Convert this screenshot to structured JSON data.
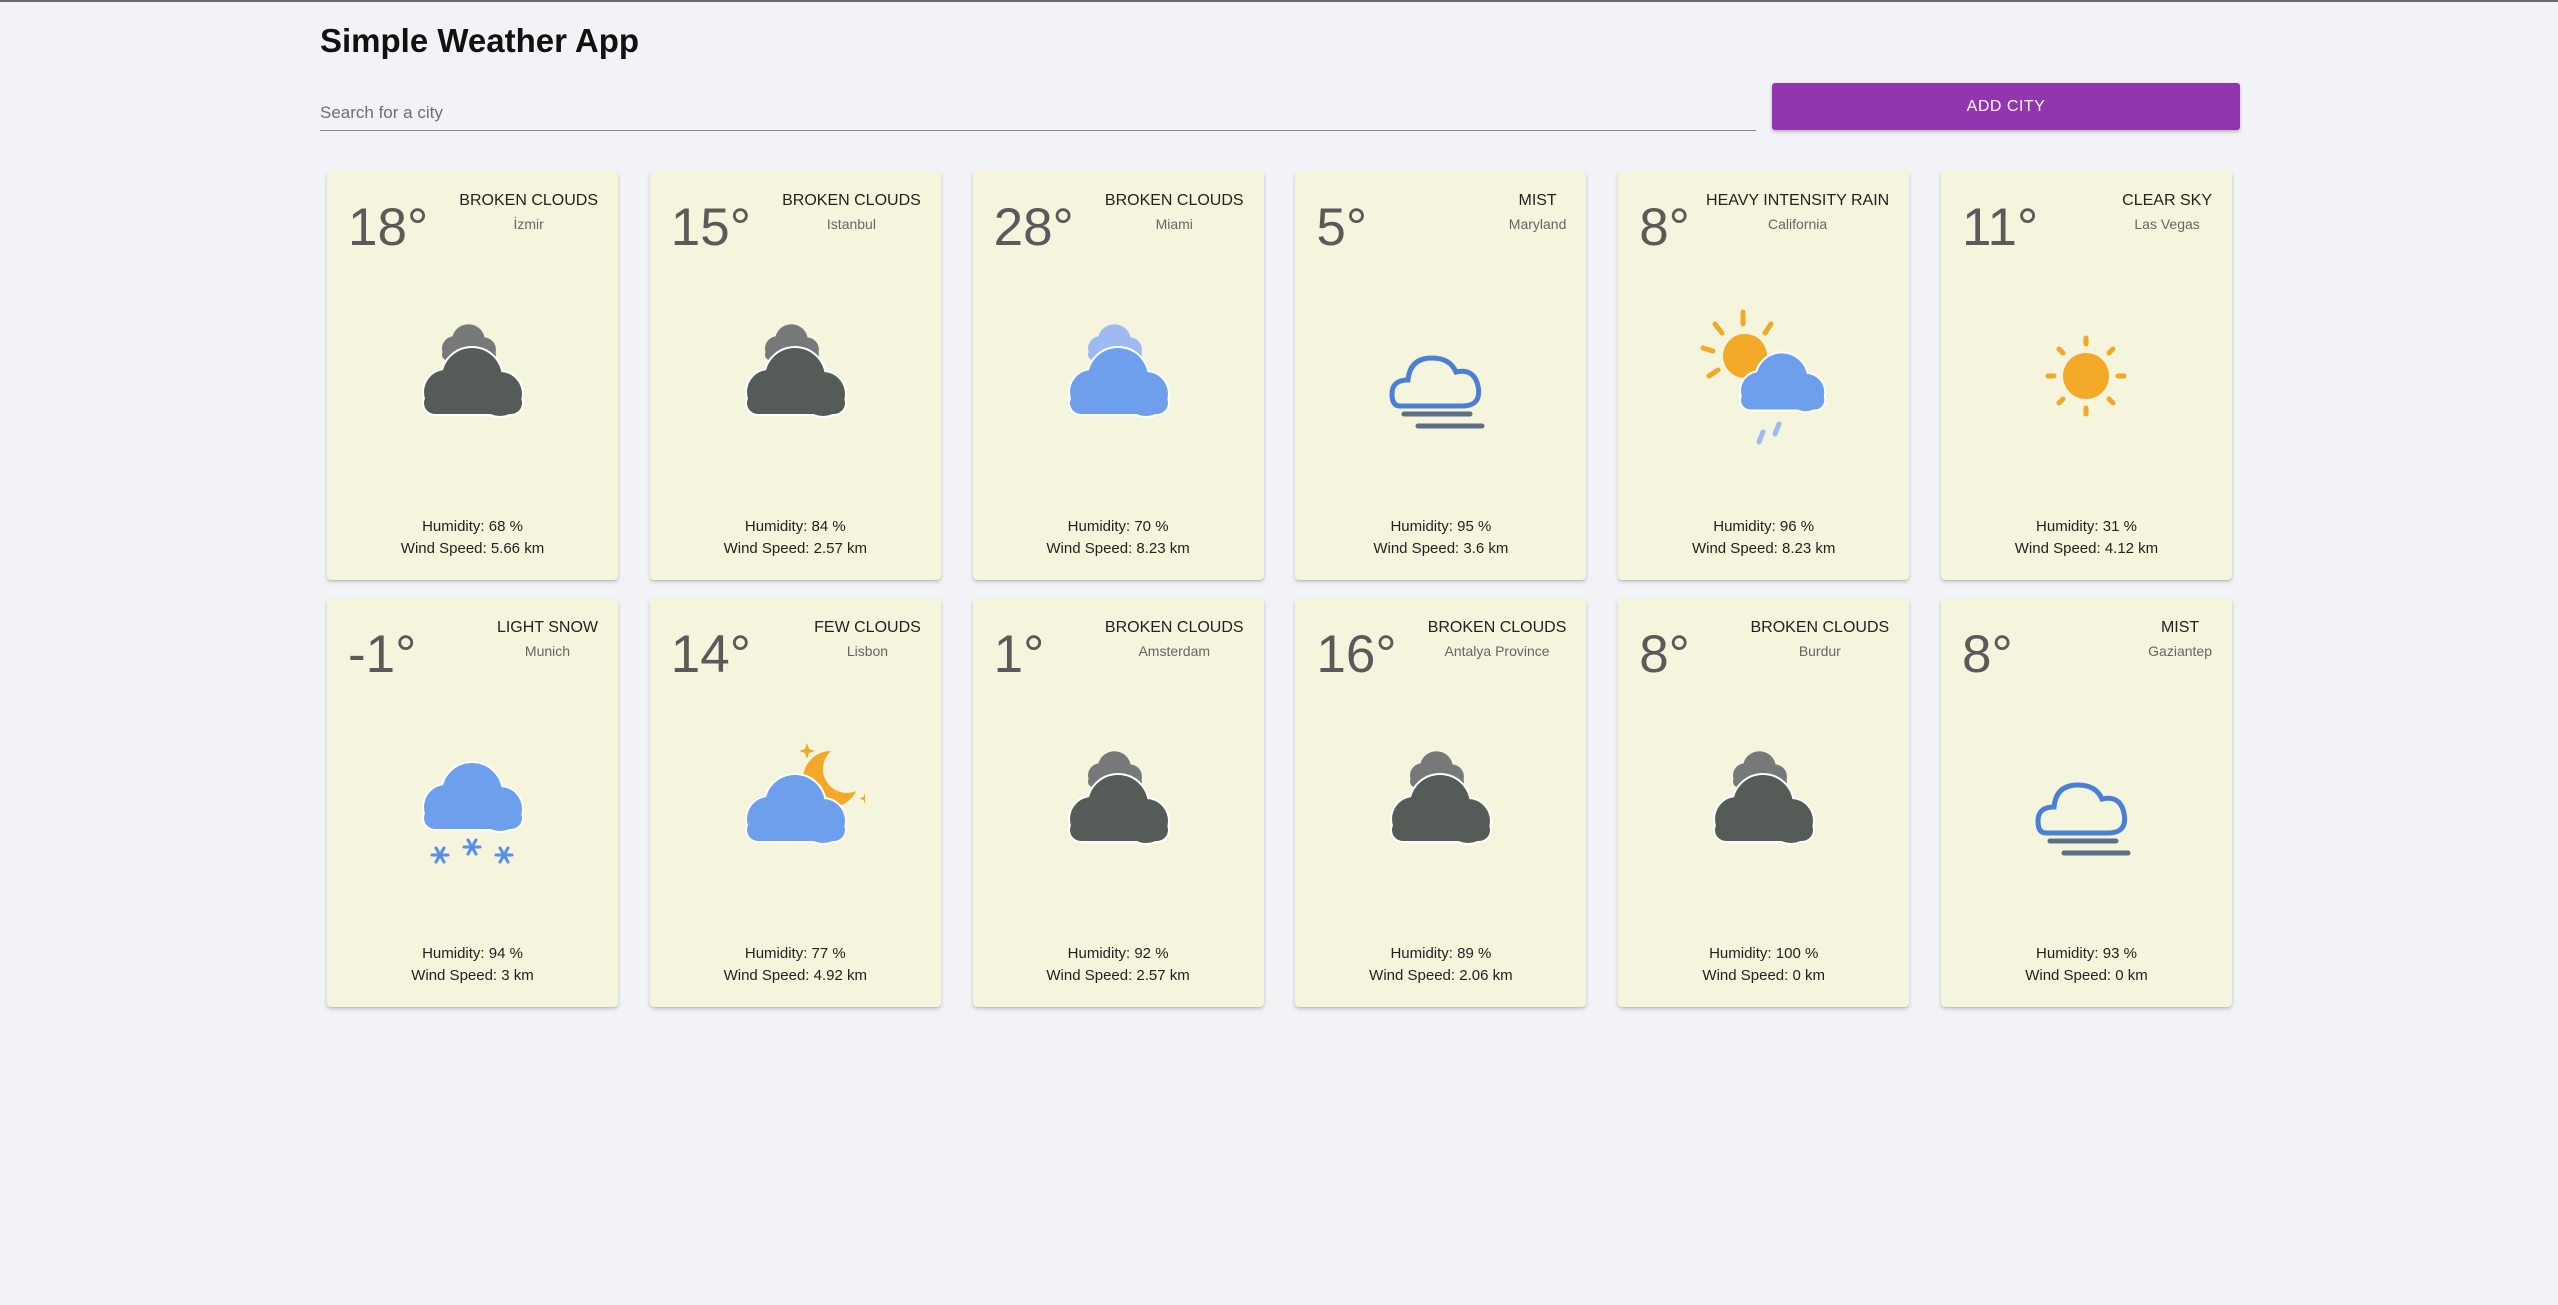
{
  "app": {
    "title": "Simple Weather App",
    "search_placeholder": "Search for a city",
    "add_button_label": "ADD CITY",
    "accent": "#9334b0"
  },
  "cards": [
    {
      "temp": "18°",
      "description": "BROKEN CLOUDS",
      "city": "İzmir",
      "humidity": "Humidity: 68 %",
      "wind": "Wind Speed: 5.66 km",
      "icon": "broken-clouds-icon"
    },
    {
      "temp": "15°",
      "description": "BROKEN CLOUDS",
      "city": "Istanbul",
      "humidity": "Humidity: 84 %",
      "wind": "Wind Speed: 2.57 km",
      "icon": "broken-clouds-icon"
    },
    {
      "temp": "28°",
      "description": "BROKEN CLOUDS",
      "city": "Miami",
      "humidity": "Humidity: 70 %",
      "wind": "Wind Speed: 8.23 km",
      "icon": "broken-clouds-day-icon"
    },
    {
      "temp": "5°",
      "description": "MIST",
      "city": "Maryland",
      "humidity": "Humidity: 95 %",
      "wind": "Wind Speed: 3.6 km",
      "icon": "mist-icon"
    },
    {
      "temp": "8°",
      "description": "HEAVY INTENSITY RAIN",
      "city": "California",
      "humidity": "Humidity: 96 %",
      "wind": "Wind Speed: 8.23 km",
      "icon": "sun-rain-icon"
    },
    {
      "temp": "11°",
      "description": "CLEAR SKY",
      "city": "Las Vegas",
      "humidity": "Humidity: 31 %",
      "wind": "Wind Speed: 4.12 km",
      "icon": "sun-icon"
    },
    {
      "temp": "-1°",
      "description": "LIGHT SNOW",
      "city": "Munich",
      "humidity": "Humidity: 94 %",
      "wind": "Wind Speed: 3 km",
      "icon": "snow-icon"
    },
    {
      "temp": "14°",
      "description": "FEW CLOUDS",
      "city": "Lisbon",
      "humidity": "Humidity: 77 %",
      "wind": "Wind Speed: 4.92 km",
      "icon": "cloud-moon-icon"
    },
    {
      "temp": "1°",
      "description": "BROKEN CLOUDS",
      "city": "Amsterdam",
      "humidity": "Humidity: 92 %",
      "wind": "Wind Speed: 2.57 km",
      "icon": "broken-clouds-icon"
    },
    {
      "temp": "16°",
      "description": "BROKEN CLOUDS",
      "city": "Antalya Province",
      "humidity": "Humidity: 89 %",
      "wind": "Wind Speed: 2.06 km",
      "icon": "broken-clouds-icon"
    },
    {
      "temp": "8°",
      "description": "BROKEN CLOUDS",
      "city": "Burdur",
      "humidity": "Humidity: 100 %",
      "wind": "Wind Speed: 0 km",
      "icon": "broken-clouds-icon"
    },
    {
      "temp": "8°",
      "description": "MIST",
      "city": "Gaziantep",
      "humidity": "Humidity: 93 %",
      "wind": "Wind Speed: 0 km",
      "icon": "mist-icon"
    }
  ]
}
